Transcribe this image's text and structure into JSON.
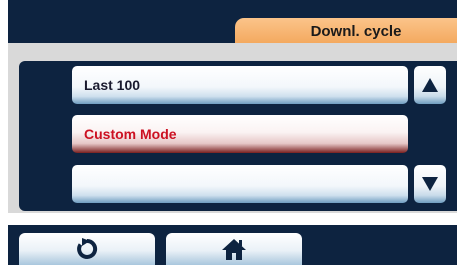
{
  "header": {
    "title": "Downl. cycle"
  },
  "list": {
    "items": [
      {
        "label": "Last 100",
        "selected": false
      },
      {
        "label": "Custom Mode",
        "selected": true
      },
      {
        "label": "",
        "selected": false
      }
    ]
  },
  "scroll": {
    "up_icon": "triangle-up-icon",
    "down_icon": "triangle-down-icon"
  },
  "footer": {
    "back_icon": "back-arrow-icon",
    "home_icon": "home-icon"
  },
  "colors": {
    "dark_navy": "#0d2340",
    "header_orange": "#f3a75c",
    "selected_text": "#cc1122",
    "panel_gray": "#d9d9d9"
  }
}
